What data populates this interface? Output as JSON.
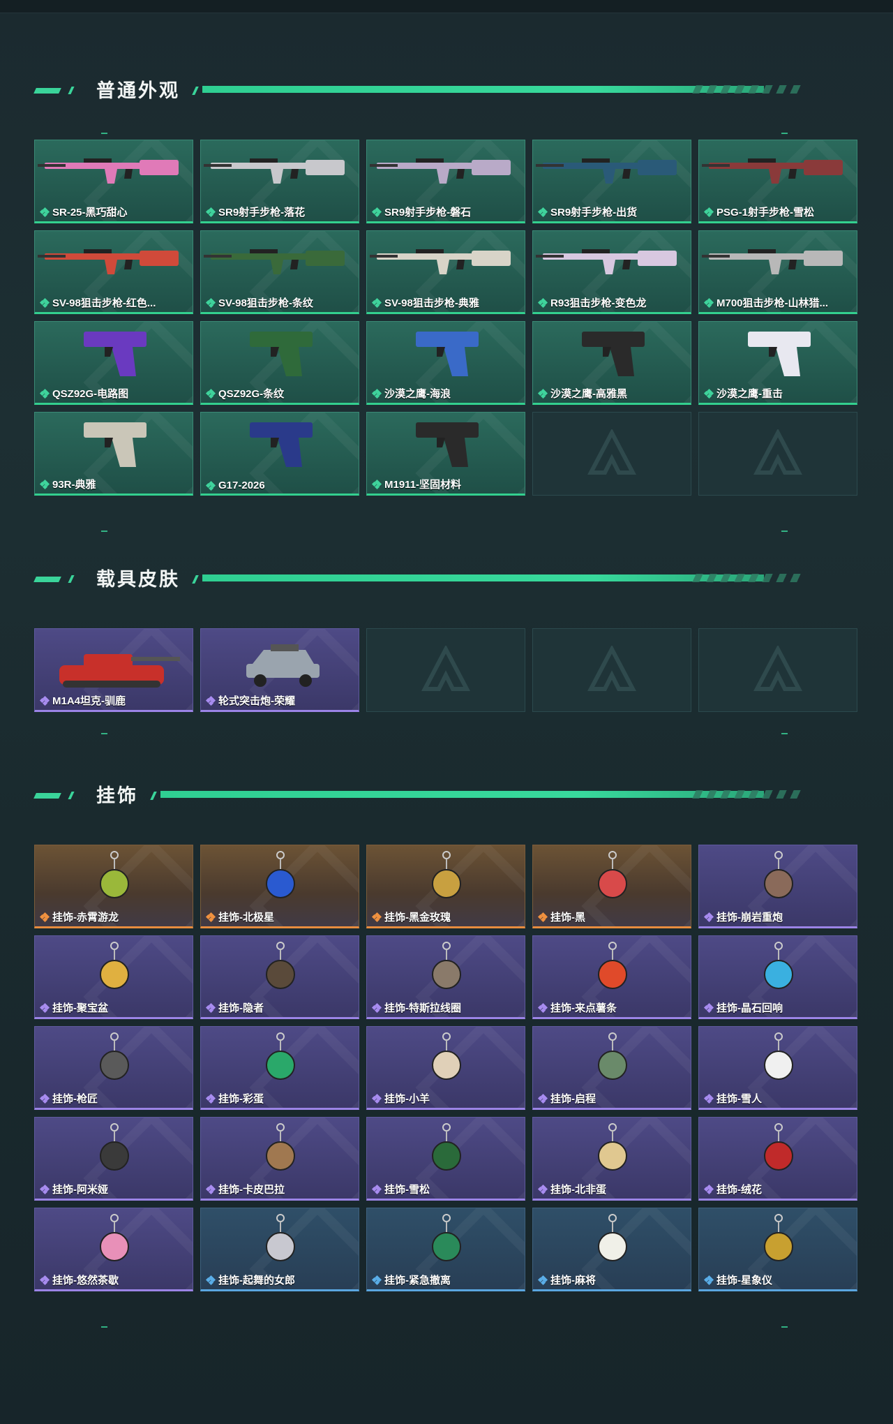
{
  "sections": [
    {
      "title": "普通外观",
      "cards": [
        {
          "label": "SR-25-黑巧甜心",
          "rarity": "green",
          "icon": "rifle-icon",
          "color": "#e07ab8"
        },
        {
          "label": "SR9射手步枪-落花",
          "rarity": "green",
          "icon": "rifle-icon",
          "color": "#c8c8cc"
        },
        {
          "label": "SR9射手步枪-磐石",
          "rarity": "green",
          "icon": "rifle-icon",
          "color": "#b9aac8"
        },
        {
          "label": "SR9射手步枪-出货",
          "rarity": "green",
          "icon": "rifle-icon",
          "color": "#2a5a78"
        },
        {
          "label": "PSG-1射手步枪-雪松",
          "rarity": "green",
          "icon": "rifle-icon",
          "color": "#8a3a3a"
        },
        {
          "label": "SV-98狙击步枪-红色...",
          "rarity": "green",
          "icon": "sniper-icon",
          "color": "#d04a3a"
        },
        {
          "label": "SV-98狙击步枪-条纹",
          "rarity": "green",
          "icon": "sniper-icon",
          "color": "#3a6a3a"
        },
        {
          "label": "SV-98狙击步枪-典雅",
          "rarity": "green",
          "icon": "sniper-icon",
          "color": "#d8d4c8"
        },
        {
          "label": "R93狙击步枪-变色龙",
          "rarity": "green",
          "icon": "sniper-icon",
          "color": "#d8c8e0"
        },
        {
          "label": "M700狙击步枪-山林猎...",
          "rarity": "green",
          "icon": "sniper-icon",
          "color": "#b8b8b8"
        },
        {
          "label": "QSZ92G-电路图",
          "rarity": "green",
          "icon": "pistol-icon",
          "color": "#6a3ac0"
        },
        {
          "label": "QSZ92G-条纹",
          "rarity": "green",
          "icon": "pistol-icon",
          "color": "#2f6a3a"
        },
        {
          "label": "沙漠之鹰-海浪",
          "rarity": "green",
          "icon": "pistol-icon",
          "color": "#3a6ac8"
        },
        {
          "label": "沙漠之鹰-高雅黑",
          "rarity": "green",
          "icon": "pistol-icon",
          "color": "#2a2a2a"
        },
        {
          "label": "沙漠之鹰-重击",
          "rarity": "green",
          "icon": "pistol-icon",
          "color": "#e8e8f0"
        },
        {
          "label": "93R-典雅",
          "rarity": "green",
          "icon": "pistol-icon",
          "color": "#cac6b8"
        },
        {
          "label": "G17-2026",
          "rarity": "green",
          "icon": "pistol-icon",
          "color": "#2a3a8a"
        },
        {
          "label": "M1911-坚固材料",
          "rarity": "green",
          "icon": "pistol-icon",
          "color": "#2a2a2a"
        },
        {
          "label": "",
          "rarity": "empty"
        },
        {
          "label": "",
          "rarity": "empty"
        }
      ]
    },
    {
      "title": "载具皮肤",
      "cards": [
        {
          "label": "M1A4坦克-驯鹿",
          "rarity": "purple",
          "icon": "tank-icon",
          "color": "#c8302a"
        },
        {
          "label": "轮式突击炮-荣耀",
          "rarity": "purple",
          "icon": "armored-car-icon",
          "color": "#9aa4ae"
        },
        {
          "label": "",
          "rarity": "empty"
        },
        {
          "label": "",
          "rarity": "empty"
        },
        {
          "label": "",
          "rarity": "empty"
        }
      ]
    },
    {
      "title": "挂饰",
      "cards": [
        {
          "label": "挂饰-赤霄游龙",
          "rarity": "orange",
          "icon": "charm-icon",
          "color": "#9ab83a"
        },
        {
          "label": "挂饰-北极星",
          "rarity": "orange",
          "icon": "charm-icon",
          "color": "#2a5ad0"
        },
        {
          "label": "挂饰-黑金玫瑰",
          "rarity": "orange",
          "icon": "charm-icon",
          "color": "#c8a040"
        },
        {
          "label": "挂饰-黑",
          "rarity": "orange",
          "icon": "charm-icon",
          "color": "#d84a4a"
        },
        {
          "label": "挂饰-崩岩重炮",
          "rarity": "purple",
          "icon": "charm-icon",
          "color": "#8a6a5a"
        },
        {
          "label": "挂饰-聚宝盆",
          "rarity": "purple",
          "icon": "charm-icon",
          "color": "#e0b040"
        },
        {
          "label": "挂饰-隐者",
          "rarity": "purple",
          "icon": "charm-icon",
          "color": "#5a4a3a"
        },
        {
          "label": "挂饰-特斯拉线圈",
          "rarity": "purple",
          "icon": "charm-icon",
          "color": "#8a7a6a"
        },
        {
          "label": "挂饰-来点薯条",
          "rarity": "purple",
          "icon": "charm-icon",
          "color": "#e04a2a"
        },
        {
          "label": "挂饰-晶石回响",
          "rarity": "purple",
          "icon": "charm-icon",
          "color": "#3ab0e0"
        },
        {
          "label": "挂饰-枪匠",
          "rarity": "purple",
          "icon": "charm-icon",
          "color": "#5a5a5a"
        },
        {
          "label": "挂饰-彩蛋",
          "rarity": "purple",
          "icon": "charm-icon",
          "color": "#2aa86a"
        },
        {
          "label": "挂饰-小羊",
          "rarity": "purple",
          "icon": "charm-icon",
          "color": "#e0d0b8"
        },
        {
          "label": "挂饰-启程",
          "rarity": "purple",
          "icon": "charm-icon",
          "color": "#6a8a6a"
        },
        {
          "label": "挂饰-雪人",
          "rarity": "purple",
          "icon": "charm-icon",
          "color": "#f0f0f0"
        },
        {
          "label": "挂饰-阿米娅",
          "rarity": "purple",
          "icon": "charm-icon",
          "color": "#3a3a3a"
        },
        {
          "label": "挂饰-卡皮巴拉",
          "rarity": "purple",
          "icon": "charm-icon",
          "color": "#a07850"
        },
        {
          "label": "挂饰-雪松",
          "rarity": "purple",
          "icon": "charm-icon",
          "color": "#2a6a3a"
        },
        {
          "label": "挂饰-北非蛋",
          "rarity": "purple",
          "icon": "charm-icon",
          "color": "#e0c890"
        },
        {
          "label": "挂饰-绒花",
          "rarity": "purple",
          "icon": "charm-icon",
          "color": "#c02a2a"
        },
        {
          "label": "挂饰-悠然茶歇",
          "rarity": "purple",
          "icon": "charm-icon",
          "color": "#e890b8"
        },
        {
          "label": "挂饰-起舞的女郎",
          "rarity": "blue",
          "icon": "charm-icon",
          "color": "#c8c8d0"
        },
        {
          "label": "挂饰-紧急撤离",
          "rarity": "blue",
          "icon": "charm-icon",
          "color": "#2a8a5a"
        },
        {
          "label": "挂饰-麻将",
          "rarity": "blue",
          "icon": "charm-icon",
          "color": "#f0f0e8"
        },
        {
          "label": "挂饰-星象仪",
          "rarity": "blue",
          "icon": "charm-icon",
          "color": "#c8a030"
        }
      ]
    }
  ]
}
